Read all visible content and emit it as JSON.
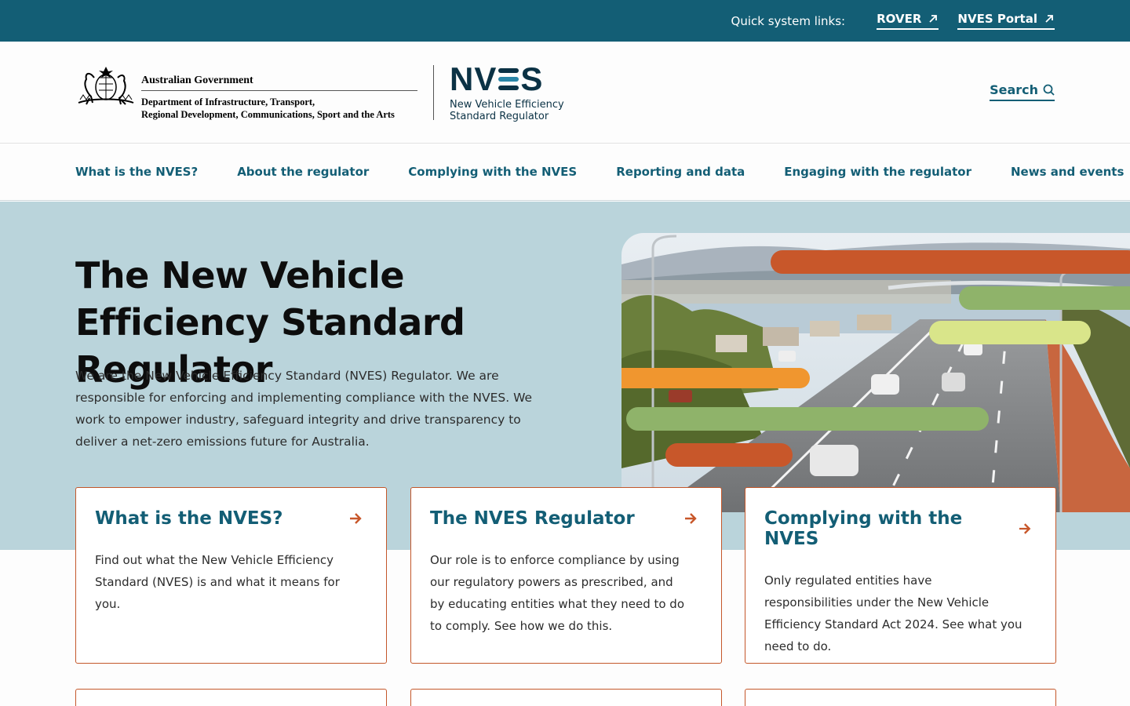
{
  "utility": {
    "label": "Quick system links:",
    "links": [
      {
        "label": "ROVER"
      },
      {
        "label": "NVES Portal"
      }
    ]
  },
  "header": {
    "gov_name": "Australian Government",
    "dept_line1": "Department of Infrastructure, Transport,",
    "dept_line2": "Regional Development, Communications, Sport and the Arts",
    "logo_letters_n": "N",
    "logo_letters_v": "V",
    "logo_letters_s": "S",
    "logo_sub_line1": "New Vehicle Efficiency",
    "logo_sub_line2": "Standard Regulator",
    "search_label": "Search"
  },
  "nav": {
    "items": [
      {
        "label": "What is the NVES?"
      },
      {
        "label": "About the regulator"
      },
      {
        "label": "Complying with the NVES"
      },
      {
        "label": "Reporting and data"
      },
      {
        "label": "Engaging with the regulator"
      },
      {
        "label": "News and events"
      }
    ]
  },
  "hero": {
    "title": "The New Vehicle Efficiency Standard Regulator",
    "description": "We are the New Vehicle Efficiency Standard (NVES) Regulator. We are responsible for enforcing and implementing compliance with the NVES. We work to empower industry, safeguard integrity and drive transparency to deliver a net-zero emissions future for Australia."
  },
  "cards": [
    {
      "title": "What is the NVES?",
      "body": "Find out what the New Vehicle Efficiency Standard (NVES) is and what it means for you."
    },
    {
      "title": "The NVES Regulator",
      "body": "Our role is to enforce compliance by using our regulatory powers as prescribed, and by educating entities what they need to do to comply. See how we do this."
    },
    {
      "title": "Complying with the NVES",
      "body": "Only regulated entities have responsibilities under the New Vehicle Efficiency Standard Act 2024. See what you need to do."
    }
  ],
  "colors": {
    "brand_teal": "#135e75",
    "accent_orange": "#c4572a",
    "hero_bg": "#bad4db",
    "logo_dark": "#0b3245"
  }
}
